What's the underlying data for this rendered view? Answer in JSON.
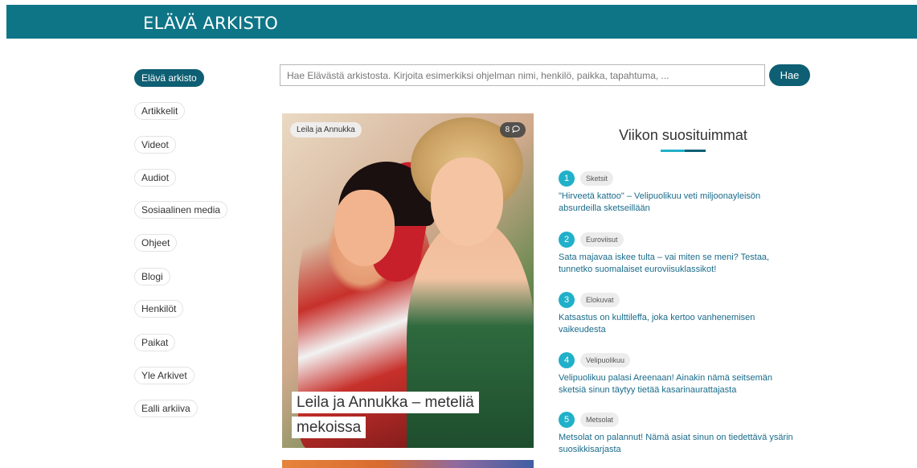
{
  "header": {
    "brand": "ELÄVÄ ARKISTO"
  },
  "sidebar": {
    "items": [
      {
        "label": "Elävä arkisto",
        "active": true
      },
      {
        "label": "Artikkelit"
      },
      {
        "label": "Videot"
      },
      {
        "label": "Audiot"
      },
      {
        "label": "Sosiaalinen media"
      },
      {
        "label": "Ohjeet"
      },
      {
        "label": "Blogi"
      },
      {
        "label": "Henkilöt"
      },
      {
        "label": "Paikat"
      },
      {
        "label": "Yle Arkivet"
      },
      {
        "label": "Ealli arkiiva"
      }
    ]
  },
  "search": {
    "placeholder": "Hae Elävästä arkistosta. Kirjoita esimerkiksi ohjelman nimi, henkilö, paikka, tapahtuma, ...",
    "button_label": "Hae"
  },
  "featured": {
    "tag": "Leila ja Annukka",
    "comment_count": "8",
    "comment_icon": "speech-bubble-icon",
    "title": "Leila ja Annukka – meteliä mekoissa"
  },
  "popular": {
    "heading": "Viikon suosituimmat",
    "items": [
      {
        "num": "1",
        "category": "Sketsit",
        "title": "\"Hirveetä kattoo\" – Velipuolikuu veti miljoonayleisön absurdeilla sketseillään"
      },
      {
        "num": "2",
        "category": "Euroviisut",
        "title": "Sata majavaa iskee tulta – vai miten se meni? Testaa, tunnetko suomalaiset euroviisuklassikot!"
      },
      {
        "num": "3",
        "category": "Elokuvat",
        "title": "Katsastus on kulttileffa, joka kertoo vanhenemisen vaikeudesta"
      },
      {
        "num": "4",
        "category": "Velipuolikuu",
        "title": "Velipuolikuu palasi Areenaan! Ainakin nämä seitsemän sketsiä sinun täytyy tietää kasarinaurattajasta"
      },
      {
        "num": "5",
        "category": "Metsolat",
        "title": "Metsolat on palannut! Nämä asiat sinun on tiedettävä ysärin suosikkisarjasta"
      }
    ]
  },
  "colors": {
    "brand": "#0e7587",
    "accent": "#20b0c9",
    "dark_accent": "#0e5f73",
    "link": "#1a6b8a"
  }
}
